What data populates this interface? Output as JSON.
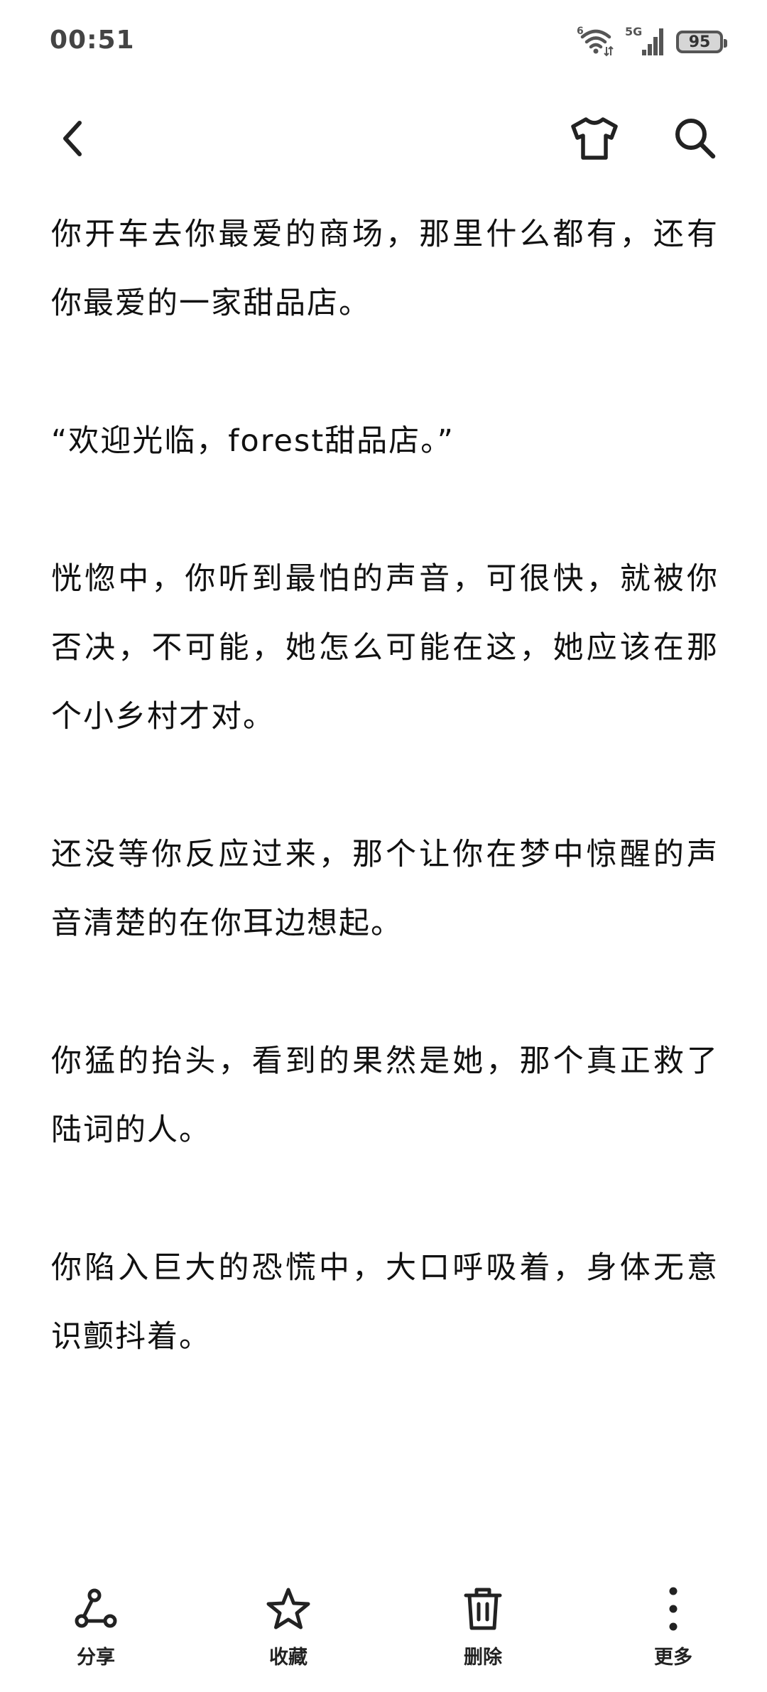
{
  "status_bar": {
    "time": "00:51",
    "battery": "95",
    "icons": [
      "wifi-icon",
      "signal-5g-icon",
      "battery-icon"
    ]
  },
  "top_nav": {
    "icons": [
      "back-arrow-icon",
      "tshirt-icon",
      "search-icon"
    ]
  },
  "content": {
    "paragraphs": [
      "你开车去你最爱的商场，那里什么都有，还有你最爱的一家甜品店。",
      "“欢迎光临，forest甜品店。”",
      "恍惚中，你听到最怕的声音，可很快，就被你否决，不可能，她怎么可能在这，她应该在那个小乡村才对。",
      "还没等你反应过来，那个让你在梦中惊醒的声音清楚的在你耳边想起。",
      "你猛的抬头，看到的果然是她，那个真正救了陆词的人。",
      "你陷入巨大的恐慌中，大口呼吸着，身体无意识颤抖着。"
    ]
  },
  "bottom_bar": {
    "share_label": "分享",
    "favorite_label": "收藏",
    "delete_label": "删除",
    "more_label": "更多"
  }
}
